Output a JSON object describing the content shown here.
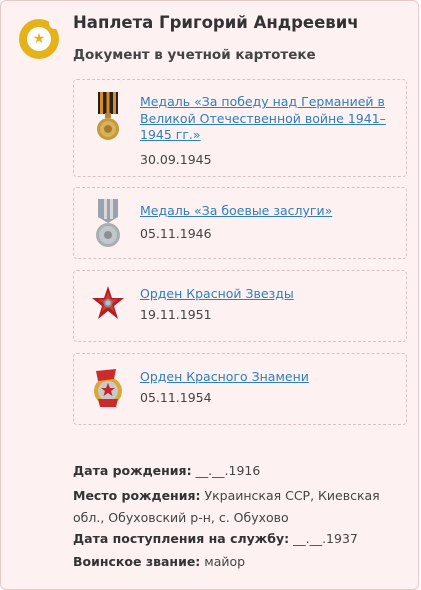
{
  "person": {
    "name": "Наплета Григорий Андреевич",
    "subtitle": "Документ в учетной картотеке"
  },
  "awards": [
    {
      "title": "Медаль «За победу над Германией в Великой Отечественной войне 1941–1945 гг.»",
      "date": "30.09.1945",
      "icon": "victory-medal-icon"
    },
    {
      "title": "Медаль «За боевые заслуги»",
      "date": "05.11.1946",
      "icon": "combat-merit-medal-icon"
    },
    {
      "title": "Орден Красной Звезды",
      "date": "19.11.1951",
      "icon": "red-star-order-icon"
    },
    {
      "title": "Орден Красного Знамени",
      "date": "05.11.1954",
      "icon": "red-banner-order-icon"
    }
  ],
  "details": {
    "birth_date_label": "Дата рождения:",
    "birth_date_value": "__.__.1916",
    "birth_place_label": "Место рождения:",
    "birth_place_value": "Украинская ССР, Киевская обл., Обуховский р-н, с. Обухово",
    "service_date_label": "Дата поступления на службу:",
    "service_date_value": "__.__.1937",
    "rank_label": "Воинское звание:",
    "rank_value": "майор"
  },
  "colors": {
    "card_background": "#fdf1f1",
    "badge": "#e5b21a",
    "link": "#2e7fb8"
  }
}
